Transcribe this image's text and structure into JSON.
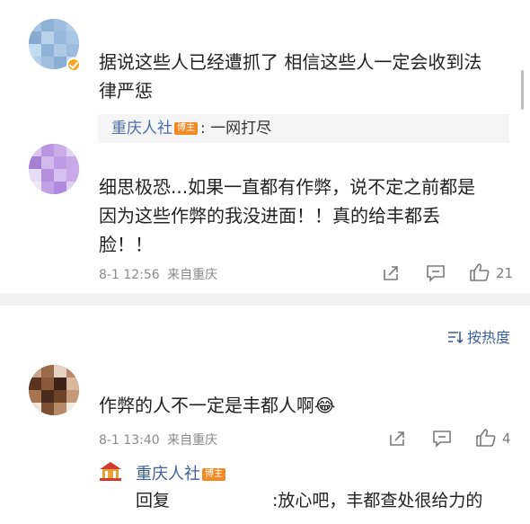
{
  "comments": [
    {
      "text_line1": "据说这些人已经遭抓了 相信这些人一定会收到法",
      "text_line2": "律严惩",
      "reply_preview": {
        "author": "重庆人社",
        "badge": "博主",
        "text": ": 一网打尽"
      }
    },
    {
      "text_line1": "细思极恐...如果一直都有作弊，说不定之前都是",
      "text_line2": "因为这些作弊的我没进面！！真的给丰都丢",
      "text_line3": "脸！！",
      "timestamp": "8-1 12:56",
      "location": "来自重庆",
      "like_count": "21"
    },
    {
      "text": "作弊的人不一定是丰都人啊",
      "emoji": "😂",
      "timestamp": "8-1 13:40",
      "location": "来自重庆",
      "like_count": "4",
      "reply": {
        "author": "重庆人社",
        "badge": "博主",
        "prefix": "回复",
        "text": ":放心吧，丰都查处很给力的"
      }
    }
  ],
  "sort": {
    "label": "按热度"
  },
  "icons": {
    "share": "share-icon",
    "comment": "comment-icon",
    "like": "like-icon",
    "sort": "sort-icon",
    "verified": "verified-badge-icon"
  },
  "colors": {
    "link": "#4a6fa8",
    "badge": "#f08a24",
    "meta": "#8a8a8a",
    "divider": "#f2f2f2"
  }
}
